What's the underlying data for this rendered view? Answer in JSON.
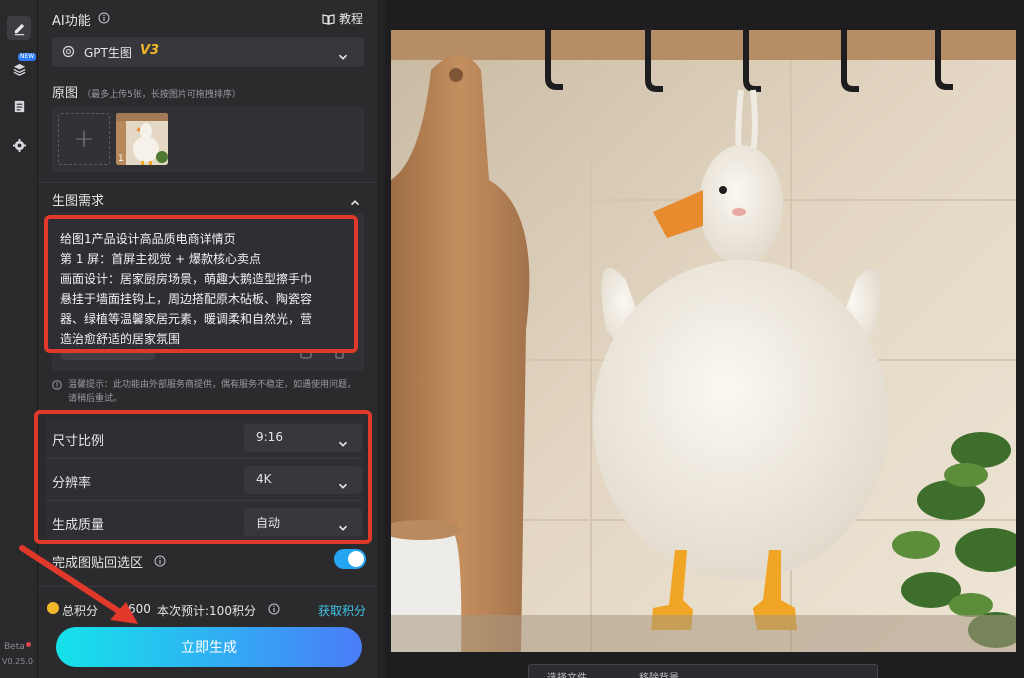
{
  "rail": {
    "new_badge": "NEW",
    "beta_label": "Beta",
    "version": "V0.25.0"
  },
  "ai_section": {
    "title": "AI功能",
    "tutorial_label": "教程",
    "function_select": {
      "value": "GPT生图",
      "version_tag": "V3"
    }
  },
  "source": {
    "title": "原图",
    "hint": "（最多上传5张，长按图片可拖拽排序）",
    "add_symbol": "+",
    "thumb_index": "1"
  },
  "prompt_section": {
    "title": "生图需求",
    "lines": [
      "给图1产品设计高品质电商详情页",
      "第 1 屏：首屏主视觉 + 爆款核心卖点",
      "画面设计：居家厨房场景，萌趣大鹅造型擦手巾",
      "悬挂于墙面挂钩上，周边搭配原木砧板、陶瓷容",
      "器、绿植等温馨家居元素，暖调柔和自然光，营",
      "造治愈舒适的居家氛围"
    ]
  },
  "tip": "温馨提示：此功能由外部服务商提供，偶有服务不稳定，如遇使用问题，请稍后重试。",
  "settings": {
    "aspect": {
      "label": "尺寸比例",
      "value": "9:16"
    },
    "resolution": {
      "label": "分辨率",
      "value": "4K"
    },
    "quality": {
      "label": "生成质量",
      "value": "自动"
    }
  },
  "paste_back": {
    "label": "完成图贴回选区",
    "enabled": true
  },
  "credits": {
    "total_label": "总积分",
    "total_value": "600",
    "estimate": "本次预计:100积分",
    "get_label": "获取积分"
  },
  "generate_button": "立即生成",
  "bottom_toolbar": {
    "item1": "选择文件",
    "item2": "移除背景"
  },
  "colors": {
    "accent_cyan": "#15e2e9",
    "accent_blue": "#4a7cf8",
    "highlight_red": "#e0392b",
    "toggle_on": "#26a6f2",
    "version_tag": "#f0b429"
  }
}
